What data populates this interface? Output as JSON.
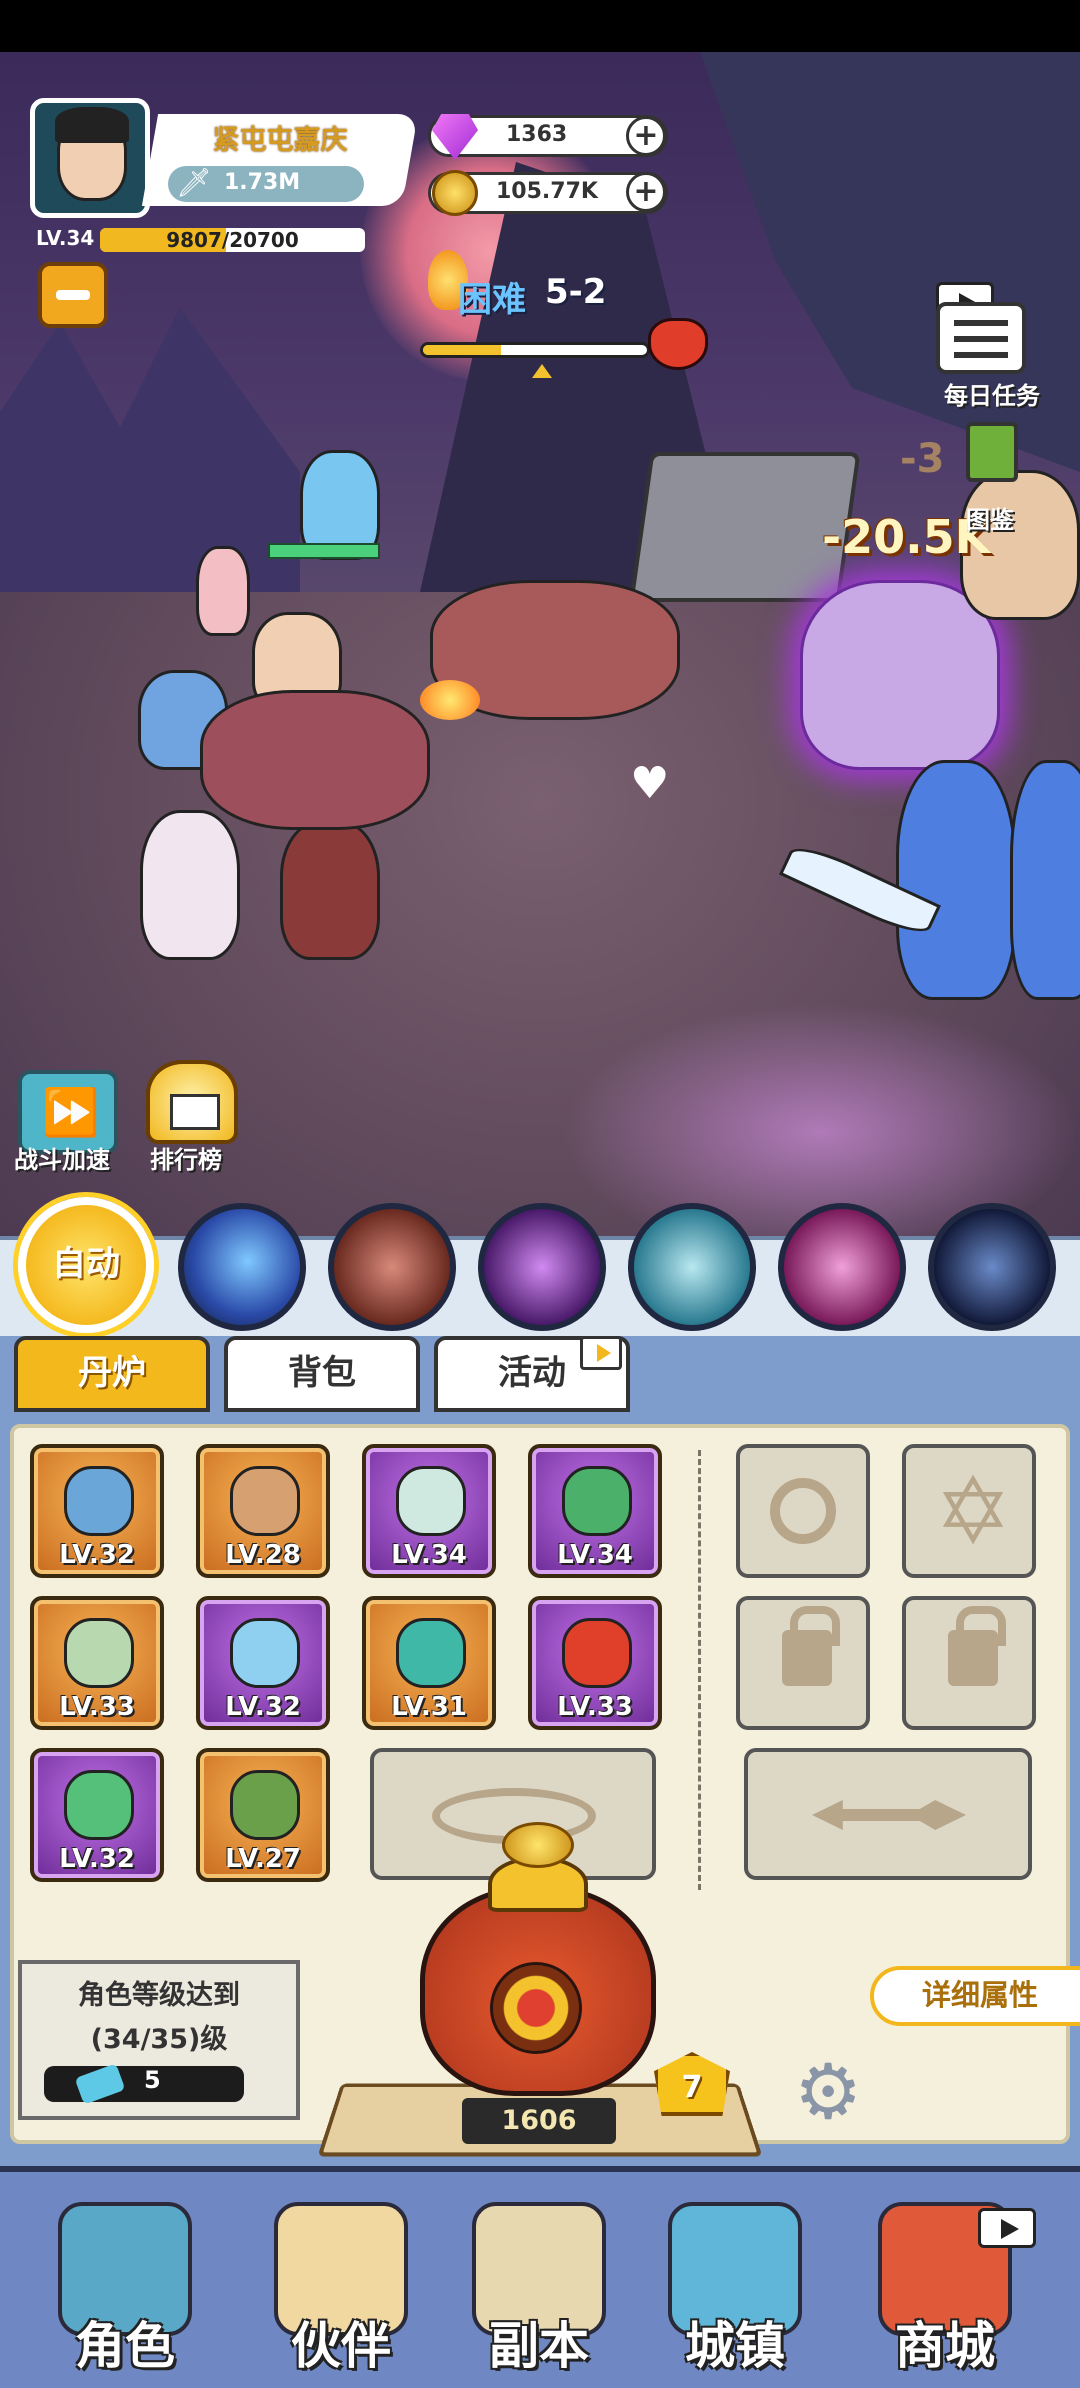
{
  "player": {
    "name": "紧屯屯嘉庆",
    "power": "1.73M",
    "level": "LV.34",
    "xp_current": "9807",
    "xp_sep": "/",
    "xp_max": "20700",
    "xp_fraction": 0.474
  },
  "resources": {
    "gems": "1363",
    "coins": "105.77K"
  },
  "stage": {
    "difficulty": "困难",
    "level": "5-2",
    "progress_fraction": 0.35
  },
  "side_menu": {
    "daily_tasks": "每日任务",
    "codex": "图鉴"
  },
  "battle": {
    "damage_main": "-20.5K",
    "damage_faded": "-3"
  },
  "battle_buttons": {
    "speed_up": "战斗加速",
    "leaderboard": "排行榜"
  },
  "skills": {
    "auto_label": "自动"
  },
  "tabs": {
    "furnace": "丹炉",
    "backpack": "背包",
    "events": "活动"
  },
  "equipment": [
    {
      "level": "LV.32",
      "rarity": "orange",
      "icon": "spear-icon"
    },
    {
      "level": "LV.28",
      "rarity": "orange",
      "icon": "scroll-icon"
    },
    {
      "level": "LV.34",
      "rarity": "purple",
      "icon": "robe-icon"
    },
    {
      "level": "LV.34",
      "rarity": "purple",
      "icon": "dragon-orb-icon"
    },
    {
      "level": "LV.33",
      "rarity": "orange",
      "icon": "fan-icon"
    },
    {
      "level": "LV.32",
      "rarity": "purple",
      "icon": "jade-disc-icon"
    },
    {
      "level": "LV.31",
      "rarity": "orange",
      "icon": "ring-icon"
    },
    {
      "level": "LV.33",
      "rarity": "purple",
      "icon": "red-bead-icon"
    },
    {
      "level": "LV.32",
      "rarity": "purple",
      "icon": "amulet-icon"
    },
    {
      "level": "LV.27",
      "rarity": "orange",
      "icon": "boots-icon"
    }
  ],
  "requirement": {
    "line1": "角色等级达到",
    "line2": "(34/35)级",
    "ticket_count": "5"
  },
  "detail_button": "详细属性",
  "furnace": {
    "count": "1606",
    "level": "7"
  },
  "nav": [
    {
      "label": "角色",
      "icon": "character-icon"
    },
    {
      "label": "伙伴",
      "icon": "partner-icon"
    },
    {
      "label": "副本",
      "icon": "dungeon-icon"
    },
    {
      "label": "城镇",
      "icon": "town-icon"
    },
    {
      "label": "商城",
      "icon": "shop-icon"
    }
  ],
  "colors": {
    "accent_gold": "#f3b81c",
    "panel_blue": "#7f9dcc",
    "orange_rarity": "#d9812c",
    "purple_rarity": "#8e3bbd"
  }
}
